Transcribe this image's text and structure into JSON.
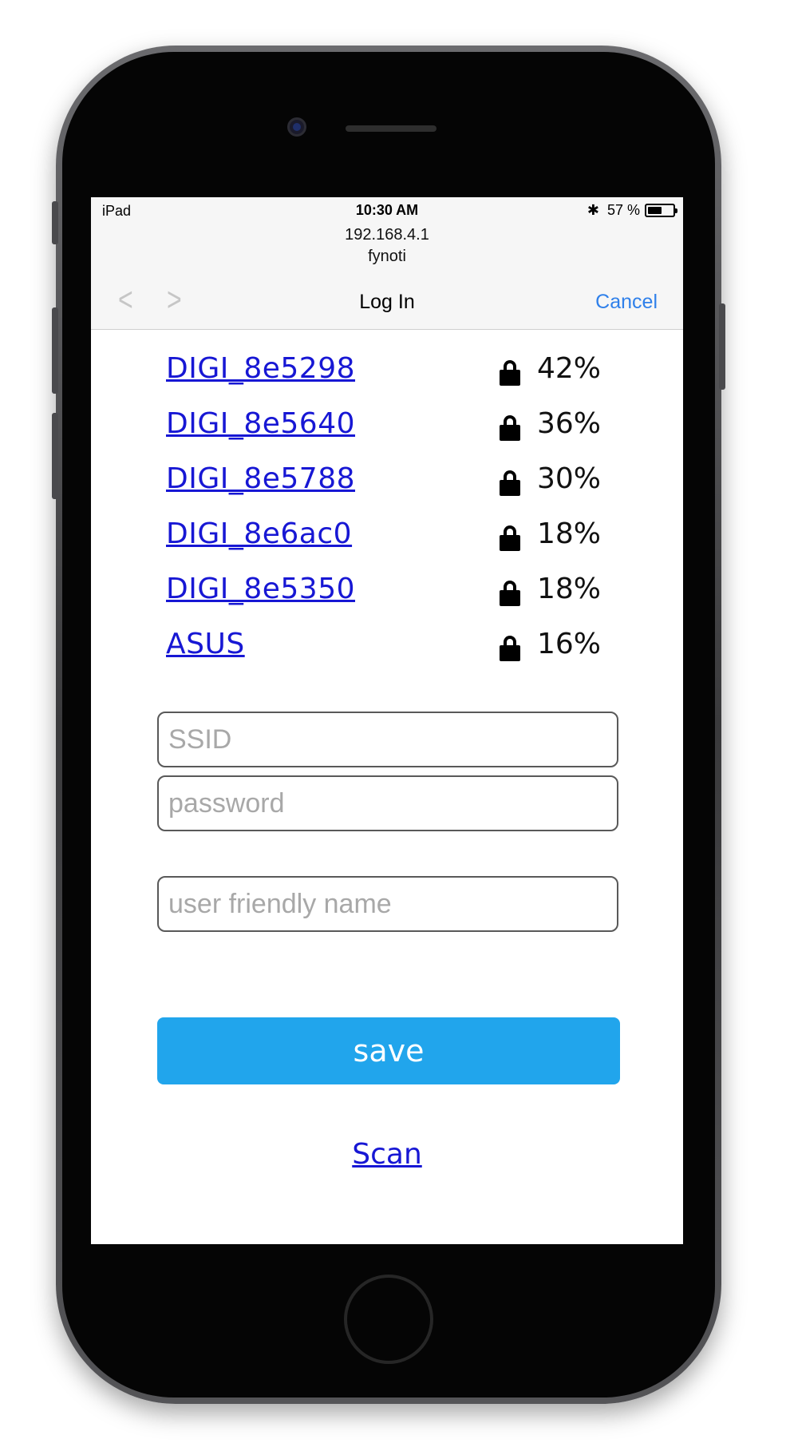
{
  "status_bar": {
    "device": "iPad",
    "time": "10:30 AM",
    "battery_text": "57 %",
    "battery_level": 0.57,
    "bluetooth_icon": "bluetooth-icon"
  },
  "address": {
    "url": "192.168.4.1",
    "site": "fynoti"
  },
  "nav": {
    "title": "Log In",
    "cancel": "Cancel",
    "back_icon": "chevron-left-icon",
    "forward_icon": "chevron-right-icon"
  },
  "networks": [
    {
      "ssid": "DIGI_8e5298",
      "strength": "42%",
      "secured": true
    },
    {
      "ssid": "DIGI_8e5640",
      "strength": "36%",
      "secured": true
    },
    {
      "ssid": "DIGI_8e5788",
      "strength": "30%",
      "secured": true
    },
    {
      "ssid": "DIGI_8e6ac0",
      "strength": "18%",
      "secured": true
    },
    {
      "ssid": "DIGI_8e5350",
      "strength": "18%",
      "secured": true
    },
    {
      "ssid": "ASUS",
      "strength": "16%",
      "secured": true
    }
  ],
  "form": {
    "ssid_placeholder": "SSID",
    "password_placeholder": "password",
    "name_placeholder": "user friendly name",
    "save_label": "save",
    "scan_label": "Scan"
  },
  "colors": {
    "link": "#1717d4",
    "save_button": "#21a5ec",
    "cancel": "#2f80ea"
  }
}
